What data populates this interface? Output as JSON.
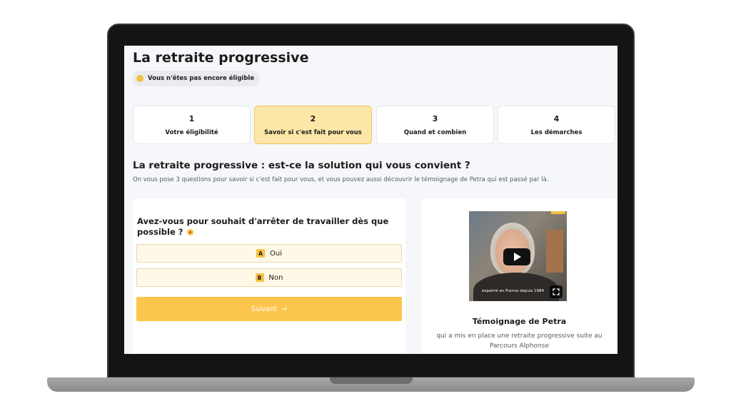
{
  "page": {
    "title": "La retraite progressive",
    "status": "Vous n'êtes pas encore éligible"
  },
  "steps": [
    {
      "number": "1",
      "label": "Votre éligibilité"
    },
    {
      "number": "2",
      "label": "Savoir si c'est fait pour vous"
    },
    {
      "number": "3",
      "label": "Quand et combien"
    },
    {
      "number": "4",
      "label": "Les démarches"
    }
  ],
  "section": {
    "title": "La retraite progressive : est-ce la solution qui vous convient ?",
    "subtitle": "On vous pose 3 questions pour savoir si c'est fait pour vous, et vous pouvez aussi découvrir le témoignage de Petra qui est passé par là."
  },
  "quiz": {
    "question": "Avez-vous pour souhait d'arrêter de travailler dès que possible ?",
    "answers": [
      {
        "key": "A",
        "label": "Oui"
      },
      {
        "key": "B",
        "label": "Non"
      }
    ],
    "next_label": "Suivant",
    "next_arrow": "→"
  },
  "video": {
    "caption": "expatrié en France depuis 1984",
    "title": "Témoignage de Petra",
    "description": "qui a mis en place une retraite progressive suite au Parcours Alphonse"
  },
  "colors": {
    "accent": "#fcc54d",
    "active_step_bg": "#fde7a8",
    "answer_bg": "#fff8e6"
  },
  "icons": [
    "status-dot-icon",
    "question-mark-icon",
    "play-icon",
    "expand-icon",
    "arrow-right-icon"
  ]
}
